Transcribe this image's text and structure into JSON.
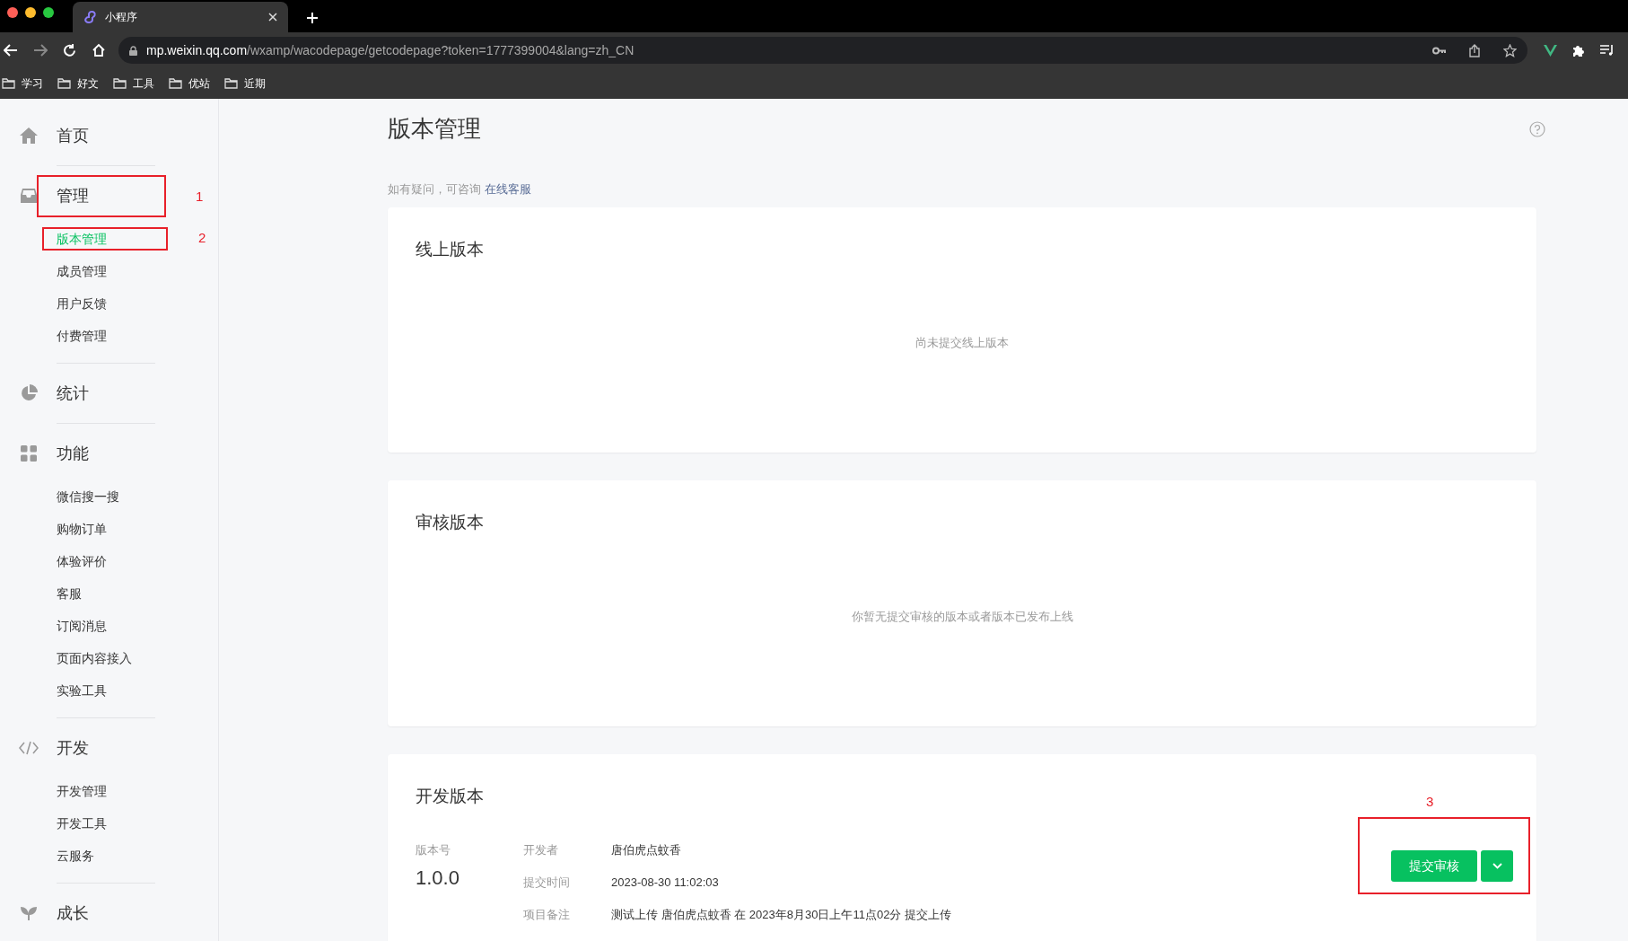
{
  "browser": {
    "tab_title": "小程序",
    "url_host": "mp.weixin.qq.com",
    "url_path": "/wxamp/wacodepage/getcodepage?token=1777399004&lang=zh_CN",
    "bookmarks": [
      "学习",
      "好文",
      "工具",
      "优站",
      "近期"
    ]
  },
  "sidebar": {
    "sections": [
      {
        "label": "首页",
        "kind": "home"
      },
      {
        "label": "管理",
        "kind": "inbox",
        "annotation": "1",
        "children": [
          {
            "label": "版本管理",
            "selected": true,
            "annotation": "2"
          },
          {
            "label": "成员管理",
            "selected": false
          },
          {
            "label": "用户反馈",
            "selected": false
          },
          {
            "label": "付费管理",
            "selected": false
          }
        ]
      },
      {
        "label": "统计",
        "kind": "pie"
      },
      {
        "label": "功能",
        "kind": "grid",
        "children": [
          {
            "label": "微信搜一搜",
            "selected": false
          },
          {
            "label": "购物订单",
            "selected": false
          },
          {
            "label": "体验评价",
            "selected": false
          },
          {
            "label": "客服",
            "selected": false
          },
          {
            "label": "订阅消息",
            "selected": false
          },
          {
            "label": "页面内容接入",
            "selected": false
          },
          {
            "label": "实验工具",
            "selected": false
          }
        ]
      },
      {
        "label": "开发",
        "kind": "code",
        "children": [
          {
            "label": "开发管理",
            "selected": false
          },
          {
            "label": "开发工具",
            "selected": false
          },
          {
            "label": "云服务",
            "selected": false
          }
        ]
      },
      {
        "label": "成长",
        "kind": "sprout"
      }
    ]
  },
  "page": {
    "title": "版本管理",
    "hint": "如有疑问，可咨询",
    "hint_link": "在线客服"
  },
  "cards": [
    {
      "kind": "empty",
      "title": "线上版本",
      "empty_text": "尚未提交线上版本"
    },
    {
      "kind": "empty",
      "title": "审核版本",
      "empty_text": "你暂无提交审核的版本或者版本已发布上线"
    },
    {
      "kind": "detail",
      "title": "开发版本",
      "version_label": "版本号",
      "version": "1.0.0",
      "fields": [
        {
          "label": "开发者",
          "value": "唐伯虎点蚊香"
        },
        {
          "label": "提交时间",
          "value": "2023-08-30 11:02:03"
        },
        {
          "label": "项目备注",
          "value": "测试上传 唐伯虎点蚊香 在 2023年8月30日上午11点02分 提交上传"
        }
      ],
      "button": "提交审核",
      "annotation": "3"
    }
  ]
}
